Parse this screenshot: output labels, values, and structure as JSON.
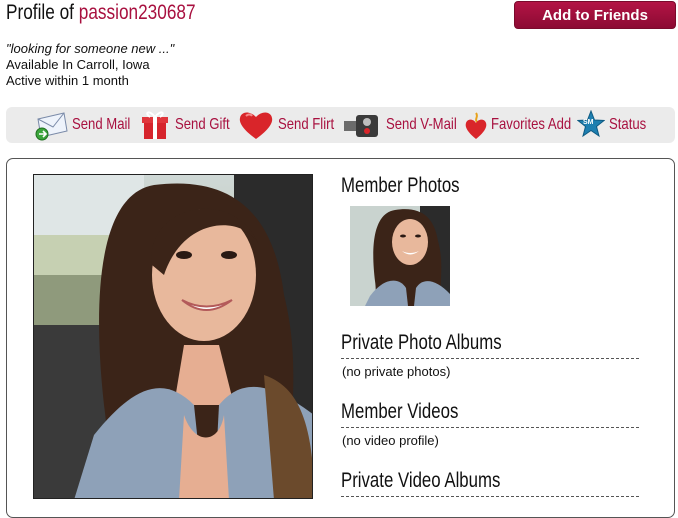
{
  "header": {
    "title_prefix": "Profile of",
    "username": "passion230687",
    "add_button": "Add to Friends"
  },
  "profile": {
    "tagline": "\"looking for someone new ...\"",
    "location": "Available In Carroll, Iowa",
    "activity": "Active within 1 month"
  },
  "toolbar": {
    "send_mail": "Send Mail",
    "send_gift": "Send Gift",
    "send_flirt": "Send Flirt",
    "send_vmail": "Send V-Mail",
    "favorites_add": "Favorites Add",
    "status": "Status",
    "status_badge": "SM"
  },
  "sections": {
    "member_photos": "Member Photos",
    "private_albums": "Private Photo Albums",
    "private_albums_empty": "(no private photos)",
    "member_videos": "Member Videos",
    "member_videos_empty": "(no video profile)",
    "private_videos": "Private Video Albums"
  },
  "colors": {
    "accent": "#a8103f",
    "button": "#9e0f3d",
    "toolbar_bg": "#ebebeb"
  }
}
